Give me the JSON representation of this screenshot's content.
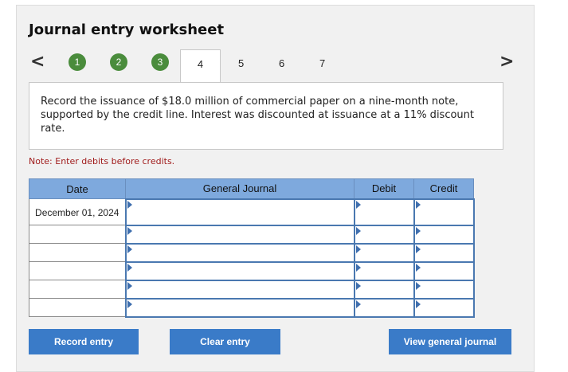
{
  "title": "Journal entry worksheet",
  "nav": {
    "prev_icon": "chevron-left-icon",
    "next_icon": "chevron-right-icon",
    "prev_glyph": "<",
    "next_glyph": ">"
  },
  "steps": [
    {
      "label": "1",
      "state": "completed"
    },
    {
      "label": "2",
      "state": "completed"
    },
    {
      "label": "3",
      "state": "completed"
    },
    {
      "label": "4",
      "state": "active"
    },
    {
      "label": "5",
      "state": "pending"
    },
    {
      "label": "6",
      "state": "pending"
    },
    {
      "label": "7",
      "state": "pending"
    }
  ],
  "prompt": "Record the issuance of $18.0 million of commercial paper on a nine-month note, supported by the credit line. Interest was discounted at issuance at a 11% discount rate.",
  "note": "Note: Enter debits before credits.",
  "table": {
    "headers": {
      "date": "Date",
      "journal": "General Journal",
      "debit": "Debit",
      "credit": "Credit"
    },
    "rows": [
      {
        "date": "December 01, 2024",
        "account": "",
        "debit": "",
        "credit": ""
      },
      {
        "date": "",
        "account": "",
        "debit": "",
        "credit": ""
      },
      {
        "date": "",
        "account": "",
        "debit": "",
        "credit": ""
      },
      {
        "date": "",
        "account": "",
        "debit": "",
        "credit": ""
      },
      {
        "date": "",
        "account": "",
        "debit": "",
        "credit": ""
      },
      {
        "date": "",
        "account": "",
        "debit": "",
        "credit": ""
      }
    ]
  },
  "buttons": {
    "record": "Record entry",
    "clear": "Clear entry",
    "view": "View general journal"
  },
  "colors": {
    "step_completed": "#4a8c3c",
    "header_blue": "#7ea9dd",
    "button_blue": "#3a7bc8",
    "note_red": "#a11d1d"
  }
}
